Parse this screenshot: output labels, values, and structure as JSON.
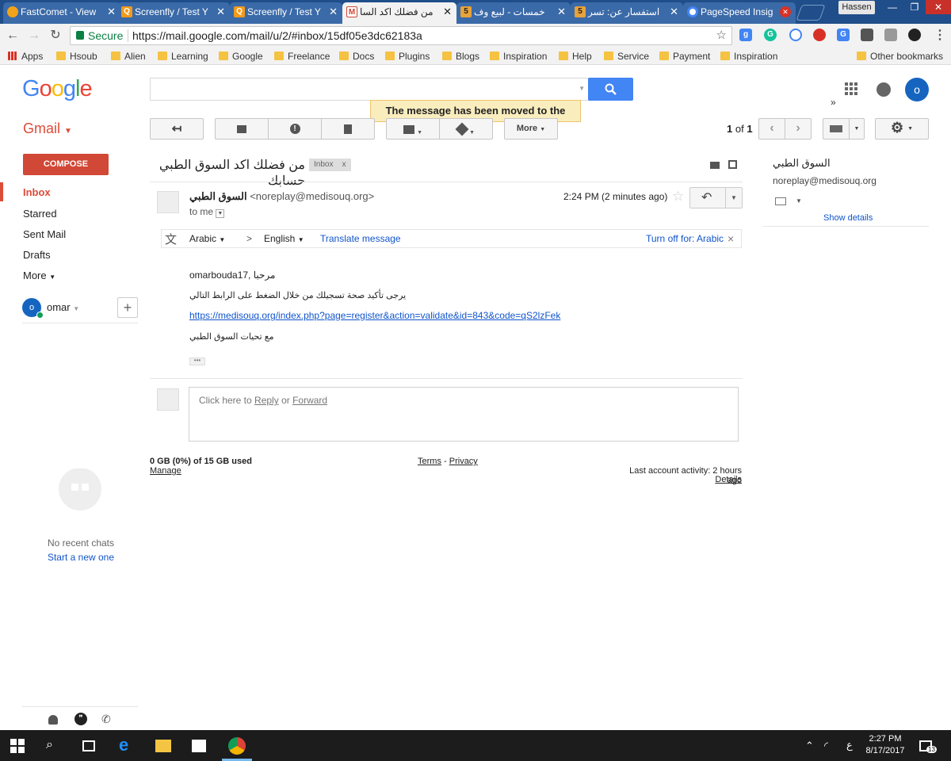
{
  "browser": {
    "tabs": [
      {
        "title": "FastComet - View",
        "favicon": "fastcomet-icon",
        "color": "#f2a31b"
      },
      {
        "title": "Screenfly / Test Y",
        "favicon": "screenfly-icon",
        "color": "#f29a1b"
      },
      {
        "title": "Screenfly / Test Y",
        "favicon": "screenfly-icon",
        "color": "#f29a1b"
      },
      {
        "title": "من فضلك اكد السا",
        "favicon": "gmail-icon",
        "color": "#d14836",
        "active": true
      },
      {
        "title": "خمسات - لبيع وف",
        "favicon": "khamsat-icon",
        "color": "#e8a23a"
      },
      {
        "title": "استفسار عن: تسر",
        "favicon": "khamsat-icon",
        "color": "#e8a23a"
      },
      {
        "title": "PageSpeed Insig",
        "favicon": "pagespeed-icon",
        "color": "#4285f4"
      }
    ],
    "profile_name": "Hassen",
    "secure_label": "Secure",
    "url": "https://mail.google.com/mail/u/2/#inbox/15df05e3dc62183a",
    "bookmarks": [
      "Apps",
      "Hsoub",
      "Alien",
      "Learning",
      "Google",
      "Freelance",
      "Docs",
      "Plugins",
      "Blogs",
      "Inspiration",
      "Help",
      "Service",
      "Payment",
      "Inspiration"
    ],
    "bookmarks_overflow": "»",
    "other_bookmarks": "Other bookmarks"
  },
  "gmail": {
    "logo": [
      "G",
      "o",
      "o",
      "g",
      "l",
      "e"
    ],
    "search_placeholder": "",
    "toast": "The message has been moved to the trash.",
    "avatar_letter": "o",
    "app_label": "Gmail",
    "toolbar": {
      "more_label": "More",
      "pager_range": "1",
      "pager_of": "of",
      "pager_total": "1"
    },
    "compose_label": "COMPOSE",
    "nav": [
      "Inbox",
      "Starred",
      "Sent Mail",
      "Drafts",
      "More"
    ],
    "account_name": "omar",
    "account_letter": "o",
    "hangouts": {
      "no_chats": "No recent chats",
      "start_new": "Start a new one"
    }
  },
  "message": {
    "subject": "من فضلك اكد السوق الطبي حسابك",
    "label_tag": "Inbox",
    "label_tag_close": "x",
    "sender_name": "السوق الطبي",
    "sender_email": "<noreplay@medisouq.org>",
    "to_me": "to me",
    "time": "2:24 PM (2 minutes ago)",
    "translate": {
      "from_lang": "Arabic",
      "arrow": ">",
      "to_lang": "English",
      "action": "Translate message",
      "turn_off": "Turn off for: Arabic",
      "close": "×"
    },
    "greeting": "omarbouda17, مرحبا",
    "line1": "يرجى تأكيد صحة تسجيلك من خلال الضغط على الرابط التالي",
    "link": "https://medisouq.org/index.php?page=register&action=validate&id=843&code=qS2lzFek",
    "signature": "مع تحيات السوق الطبي",
    "ellipsis": "•••",
    "reply_prompt": "Click here to",
    "reply_link": "Reply",
    "reply_or": "or",
    "forward_link": "Forward"
  },
  "footer": {
    "quota": "0 GB (0%) of 15 GB used",
    "manage": "Manage",
    "terms": "Terms",
    "terms_sep": "-",
    "privacy": "Privacy",
    "activity": "Last account activity: 2 hours ago",
    "details": "Details"
  },
  "contact_panel": {
    "name": "السوق الطبي",
    "email": "noreplay@medisouq.org",
    "show_details": "Show details"
  },
  "taskbar": {
    "time": "2:27 PM",
    "date": "8/17/2017",
    "lang": "ع",
    "notif_count": "13"
  }
}
